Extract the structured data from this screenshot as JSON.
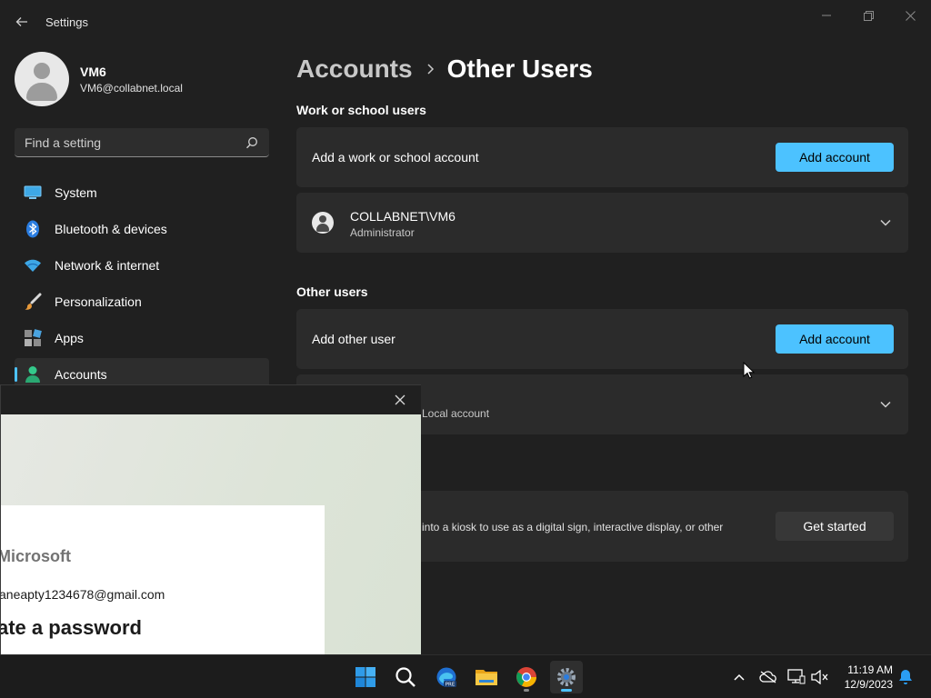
{
  "window": {
    "title": "Settings"
  },
  "profile": {
    "name": "VM6",
    "email": "VM6@collabnet.local"
  },
  "search": {
    "placeholder": "Find a setting",
    "value": ""
  },
  "sidebar": {
    "items": [
      {
        "label": "System",
        "icon": "system-icon"
      },
      {
        "label": "Bluetooth & devices",
        "icon": "bluetooth-icon"
      },
      {
        "label": "Network & internet",
        "icon": "wifi-icon"
      },
      {
        "label": "Personalization",
        "icon": "brush-icon"
      },
      {
        "label": "Apps",
        "icon": "apps-icon"
      },
      {
        "label": "Accounts",
        "icon": "accounts-icon",
        "active": true
      }
    ]
  },
  "breadcrumb": {
    "parent": "Accounts",
    "current": "Other Users"
  },
  "work_section": {
    "title": "Work or school users",
    "add_label": "Add a work or school account",
    "add_button": "Add account",
    "user": {
      "name": "COLLABNET\\VM6",
      "role": "Administrator"
    }
  },
  "other_section": {
    "title": "Other users",
    "add_label": "Add other user",
    "add_button": "Add account",
    "user_partial": "– Local account"
  },
  "kiosk": {
    "description_partial": "e into a kiosk to use as a digital sign, interactive display, or other",
    "button": "Get started"
  },
  "dialog": {
    "brand_partial": "Microsoft",
    "email_partial": "aneapty1234678@gmail.com",
    "heading_partial": "ate a password"
  },
  "taskbar": {
    "apps": [
      "start-icon",
      "search-icon",
      "edge-beta-icon",
      "file-explorer-icon",
      "chrome-icon",
      "settings-icon"
    ],
    "time": "11:19 AM",
    "date": "12/9/2023"
  },
  "colors": {
    "accent": "#4cc2ff",
    "background": "#202020",
    "card": "#2b2b2b"
  }
}
